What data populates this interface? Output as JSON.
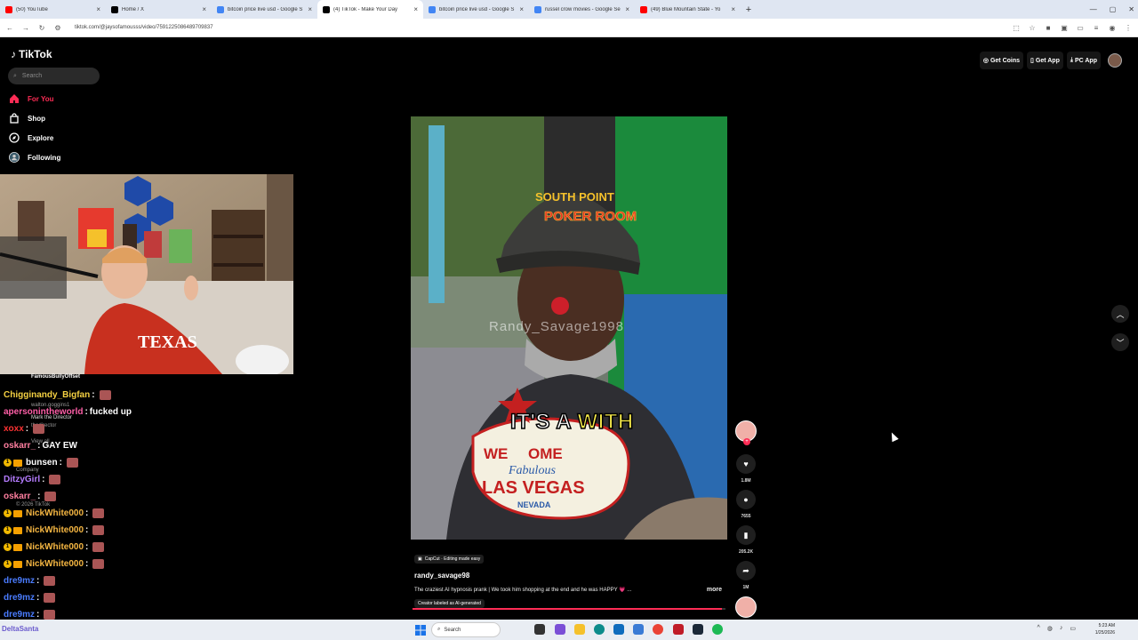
{
  "browser": {
    "tabs": [
      {
        "title": "(50) YouTube",
        "color": "#ff0000"
      },
      {
        "title": "Home / X",
        "color": "#000000"
      },
      {
        "title": "bitcoin price live usd - Google S",
        "color": "#4285f4"
      },
      {
        "title": "(4) TikTok - Make Your Day",
        "color": "#000000"
      },
      {
        "title": "bitcoin price live usd - Google S",
        "color": "#4285f4"
      },
      {
        "title": "russel crow movies - Google Se",
        "color": "#4285f4"
      },
      {
        "title": "(49) Blue Mountain State - Yo",
        "color": "#ff0000"
      }
    ],
    "active_tab": 3,
    "url": "tiktok.com/@jaysofamousss/video/7591225086489709837"
  },
  "tiktok": {
    "logo": "TikTok",
    "search_placeholder": "Search",
    "nav": [
      {
        "label": "For You",
        "icon": "home-icon",
        "active": true
      },
      {
        "label": "Shop",
        "icon": "shop-icon",
        "active": false
      },
      {
        "label": "Explore",
        "icon": "compass-icon",
        "active": false
      },
      {
        "label": "Following",
        "icon": "following-icon",
        "active": false
      }
    ],
    "top_actions": [
      "Get Coins",
      "Get App",
      "PC App"
    ],
    "video": {
      "watermark": "Randy_Savage1998",
      "caption_white": "IT'S A ",
      "caption_yellow": "WITH",
      "hat_text": "SOUTH POINT POKER ROOM",
      "sign_text": "WELCOME TO Fabulous LAS VEGAS NEVADA",
      "progress": 0.99
    },
    "actions": {
      "likes": "1.8M",
      "comments": "7655",
      "saves": "205.2K",
      "shares": "1M"
    },
    "meta": {
      "capcut": "CapCut · Editing made easy",
      "author": "randy_savage98",
      "description": "The craziest AI hypnosis prank | We took him shopping at the end and he was HAPPY 💗 ...",
      "more": "more",
      "ai_label": "Creator labeled as AI-generated"
    }
  },
  "overlay_small": {
    "user1": "FamousBullyOffset",
    "user2": "walton.goggins1",
    "user3": "Mark the Director",
    "user4": "thedirector",
    "view_all": "View all",
    "company": "Company",
    "copyright": "© 2026 TikTok"
  },
  "chat": [
    {
      "user": "Chigginandy_Bigfan",
      "color": "#f5d142",
      "msg": "",
      "emote": true,
      "badge": false
    },
    {
      "user": "apersonintheworld",
      "color": "#ff5fa8",
      "msg": "fucked up",
      "emote": false,
      "badge": false
    },
    {
      "user": "xoxx",
      "color": "#ff3333",
      "msg": "",
      "emote": true,
      "badge": false
    },
    {
      "user": "oskarr_",
      "color": "#ff7fa0",
      "msg": "GAY EW",
      "emote": false,
      "badge": false
    },
    {
      "user": "bunsen",
      "color": "#ffffff",
      "msg": "",
      "emote": true,
      "badge": true
    },
    {
      "user": "DitzyGirl",
      "color": "#b57cff",
      "msg": "",
      "emote": true,
      "badge": false
    },
    {
      "user": "oskarr_",
      "color": "#ff7fa0",
      "msg": "",
      "emote": true,
      "badge": false
    },
    {
      "user": "NickWhite000",
      "color": "#f5b642",
      "msg": "",
      "emote": true,
      "badge": true
    },
    {
      "user": "NickWhite000",
      "color": "#f5b642",
      "msg": "",
      "emote": true,
      "badge": true
    },
    {
      "user": "NickWhite000",
      "color": "#f5b642",
      "msg": "",
      "emote": true,
      "badge": true
    },
    {
      "user": "NickWhite000",
      "color": "#f5b642",
      "msg": "",
      "emote": true,
      "badge": true
    },
    {
      "user": "dre9mz",
      "color": "#4a7cff",
      "msg": "",
      "emote": true,
      "badge": false
    },
    {
      "user": "dre9mz",
      "color": "#4a7cff",
      "msg": "",
      "emote": true,
      "badge": false
    },
    {
      "user": "dre9mz",
      "color": "#4a7cff",
      "msg": "",
      "emote": true,
      "badge": false
    }
  ],
  "taskbar": {
    "search": "Search",
    "time": "5:23 AM",
    "date": "1/25/2026",
    "bottom_left": "DeltaSanta"
  }
}
